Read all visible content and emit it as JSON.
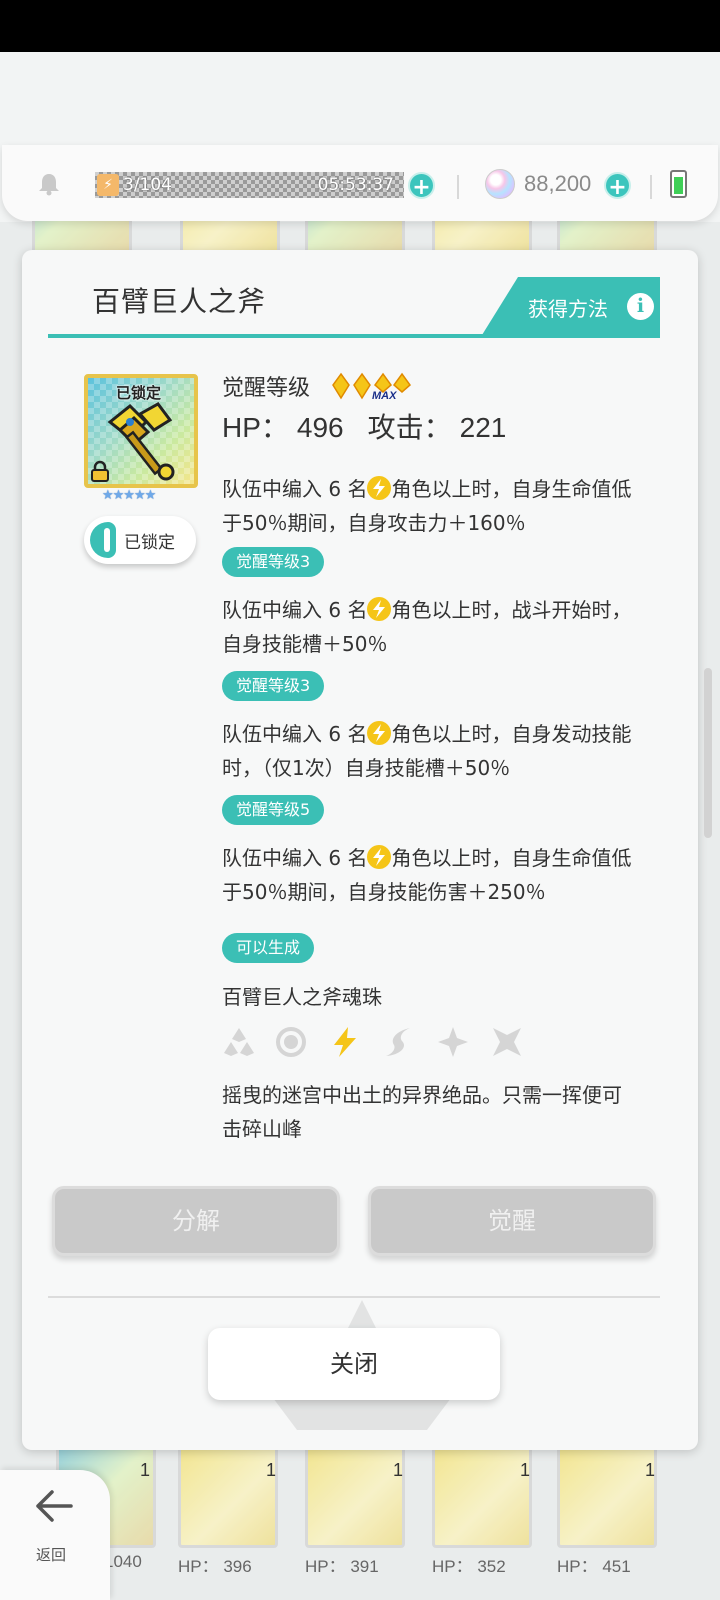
{
  "hud": {
    "stamina_count": "3/104",
    "stamina_timer": "05:53:37",
    "gem_count": "88,200"
  },
  "modal": {
    "title": "百臂巨人之斧",
    "obtain_label": "获得方法",
    "locked_mark": "已锁定",
    "stars": "★★★★★",
    "lock_toggle_label": "已锁定",
    "awaken_label": "觉醒等级",
    "awaken_max": "MAX",
    "hp_label": "HP：",
    "hp_value": "496",
    "atk_label": "攻击：",
    "atk_value": "221",
    "skills": [
      {
        "pre": "队伍中编入 6 名",
        "post": "角色以上时，自身生命值低于50％期间，自身攻击力＋160％"
      },
      {
        "tag": "觉醒等级3",
        "pre": "队伍中编入 6 名",
        "post": "角色以上时，战斗开始时，自身技能槽＋50％"
      },
      {
        "tag": "觉醒等级3",
        "pre": "队伍中编入 6 名",
        "post": "角色以上时，自身发动技能时，（仅1次）自身技能槽＋50％"
      },
      {
        "tag": "觉醒等级5",
        "pre": "队伍中编入 6 名",
        "post": "角色以上时，自身生命值低于50％期间，自身技能伤害＋250％"
      }
    ],
    "craft_tag": "可以生成",
    "craft_item": "百臂巨人之斧魂珠",
    "description": "摇曳的迷宫中出土的异界绝品。只需一挥便可击碎山峰",
    "decompose_label": "分解",
    "awaken_button_label": "觉醒",
    "close_label": "关闭"
  },
  "nav": {
    "back_label": "返回"
  },
  "background_cards": [
    {
      "count": "1",
      "hp": "1040"
    },
    {
      "count": "1",
      "hp": "HP：  396"
    },
    {
      "count": "1",
      "hp": "HP：  391"
    },
    {
      "count": "1",
      "hp": "HP：  352"
    },
    {
      "count": "1",
      "hp": "HP：  451"
    }
  ],
  "colors": {
    "accent": "#3bbfb5",
    "lightning": "#f5c518",
    "disabled_button": "#c9c9c9"
  }
}
